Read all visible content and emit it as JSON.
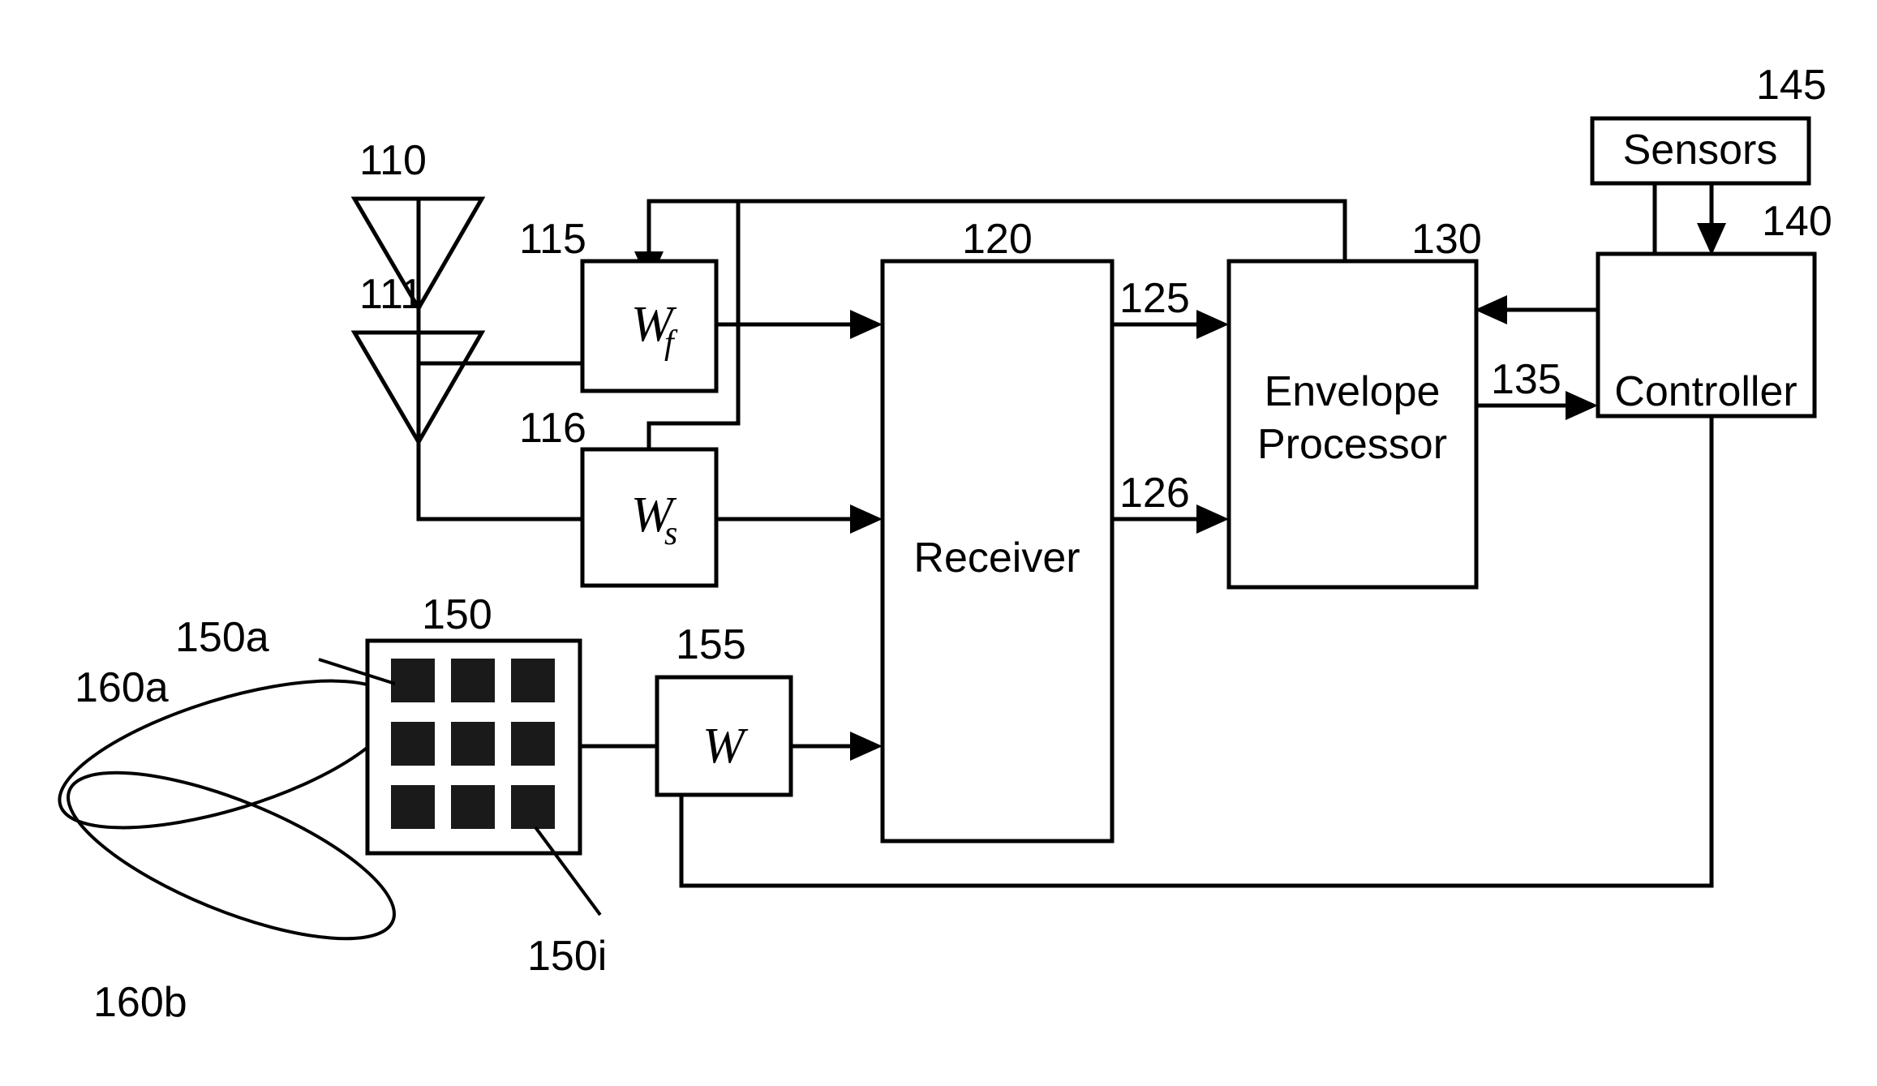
{
  "figure": {
    "type": "patent-block-diagram",
    "background_color": "#ffffff",
    "line_color": "#000000",
    "element_fill_color": "#1a1a1a"
  },
  "antennas": [
    {
      "ref": "110",
      "name": "first-antenna"
    },
    {
      "ref": "111",
      "name": "second-antenna"
    }
  ],
  "weight_blocks": [
    {
      "ref": "115",
      "label": "W",
      "subscript": "f",
      "name": "fast-weight-block"
    },
    {
      "ref": "116",
      "label": "W",
      "subscript": "s",
      "name": "slow-weight-block"
    },
    {
      "ref": "155",
      "label": "W",
      "subscript": "",
      "name": "array-weight-block"
    }
  ],
  "blocks": [
    {
      "ref": "120",
      "label": "Receiver",
      "name": "receiver-block"
    },
    {
      "ref": "130",
      "label_line1": "Envelope",
      "label_line2": "Processor",
      "name": "envelope-processor-block"
    },
    {
      "ref": "140",
      "label": "Controller",
      "name": "controller-block"
    },
    {
      "ref": "145",
      "label": "Sensors",
      "name": "sensors-block"
    },
    {
      "ref": "150",
      "label": "",
      "name": "antenna-array-block"
    }
  ],
  "signal_labels": [
    {
      "ref": "125",
      "name": "receiver-output-signal-125"
    },
    {
      "ref": "126",
      "name": "receiver-output-signal-126"
    },
    {
      "ref": "135",
      "name": "envelope-processor-output-signal-135"
    }
  ],
  "array": {
    "ref": "150",
    "rows": 3,
    "cols": 3,
    "element_first_ref": "150a",
    "element_last_ref": "150i",
    "element_count": 9
  },
  "beam_lobes": [
    {
      "ref": "160a",
      "name": "upper-beam-lobe"
    },
    {
      "ref": "160b",
      "name": "lower-beam-lobe"
    }
  ],
  "refs": {
    "r110": "110",
    "r111": "111",
    "r115": "115",
    "r116": "116",
    "r120": "120",
    "r125": "125",
    "r126": "126",
    "r130": "130",
    "r135": "135",
    "r140": "140",
    "r145": "145",
    "r150": "150",
    "r150a": "150a",
    "r150i": "150i",
    "r155": "155",
    "r160a": "160a",
    "r160b": "160b"
  },
  "text": {
    "receiver": "Receiver",
    "envelope_line1": "Envelope",
    "envelope_line2": "Processor",
    "controller": "Controller",
    "sensors": "Sensors",
    "w": "W",
    "sub_f": "f",
    "sub_s": "s"
  }
}
